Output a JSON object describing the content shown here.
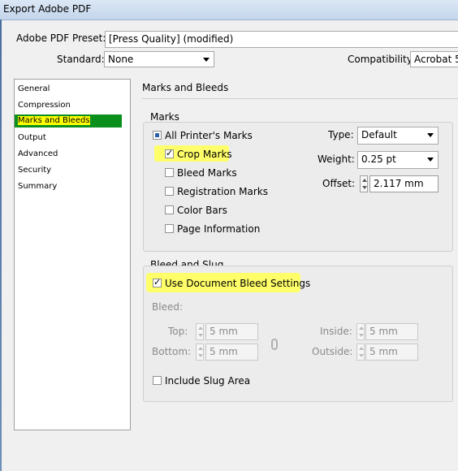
{
  "window": {
    "title": "Export Adobe PDF"
  },
  "header": {
    "preset_label": "Adobe PDF Preset:",
    "preset_value": "[Press Quality] (modified)",
    "standard_label": "Standard:",
    "standard_value": "None",
    "compatibility_label": "Compatibility:",
    "compatibility_value": "Acrobat 5"
  },
  "sidebar": {
    "items": [
      {
        "label": "General"
      },
      {
        "label": "Compression"
      },
      {
        "label": "Marks and Bleeds",
        "selected": true
      },
      {
        "label": "Output"
      },
      {
        "label": "Advanced"
      },
      {
        "label": "Security"
      },
      {
        "label": "Summary"
      }
    ]
  },
  "panel": {
    "title": "Marks and Bleeds"
  },
  "marks": {
    "group_title": "Marks",
    "all_printers_marks": "All Printer's Marks",
    "crop_marks": "Crop Marks",
    "bleed_marks": "Bleed Marks",
    "registration_marks": "Registration Marks",
    "color_bars": "Color Bars",
    "page_information": "Page Information",
    "type_label": "Type:",
    "type_value": "Default",
    "weight_label": "Weight:",
    "weight_value": "0.25 pt",
    "offset_label": "Offset:",
    "offset_value": "2.117 mm"
  },
  "bleed_slug": {
    "group_title": "Bleed and Slug",
    "use_document_bleed": "Use Document Bleed Settings",
    "bleed_label": "Bleed:",
    "top_label": "Top:",
    "top_value": "5 mm",
    "bottom_label": "Bottom:",
    "bottom_value": "5 mm",
    "inside_label": "Inside:",
    "inside_value": "5 mm",
    "outside_label": "Outside:",
    "outside_value": "5 mm",
    "include_slug": "Include Slug Area"
  },
  "colors": {
    "highlight": "#ffff00",
    "selection": "#0a8f1d"
  },
  "icons": {
    "link": "chain-link-icon",
    "dropdown": "chevron-down-icon",
    "spinner": "spinner-arrows-icon"
  }
}
